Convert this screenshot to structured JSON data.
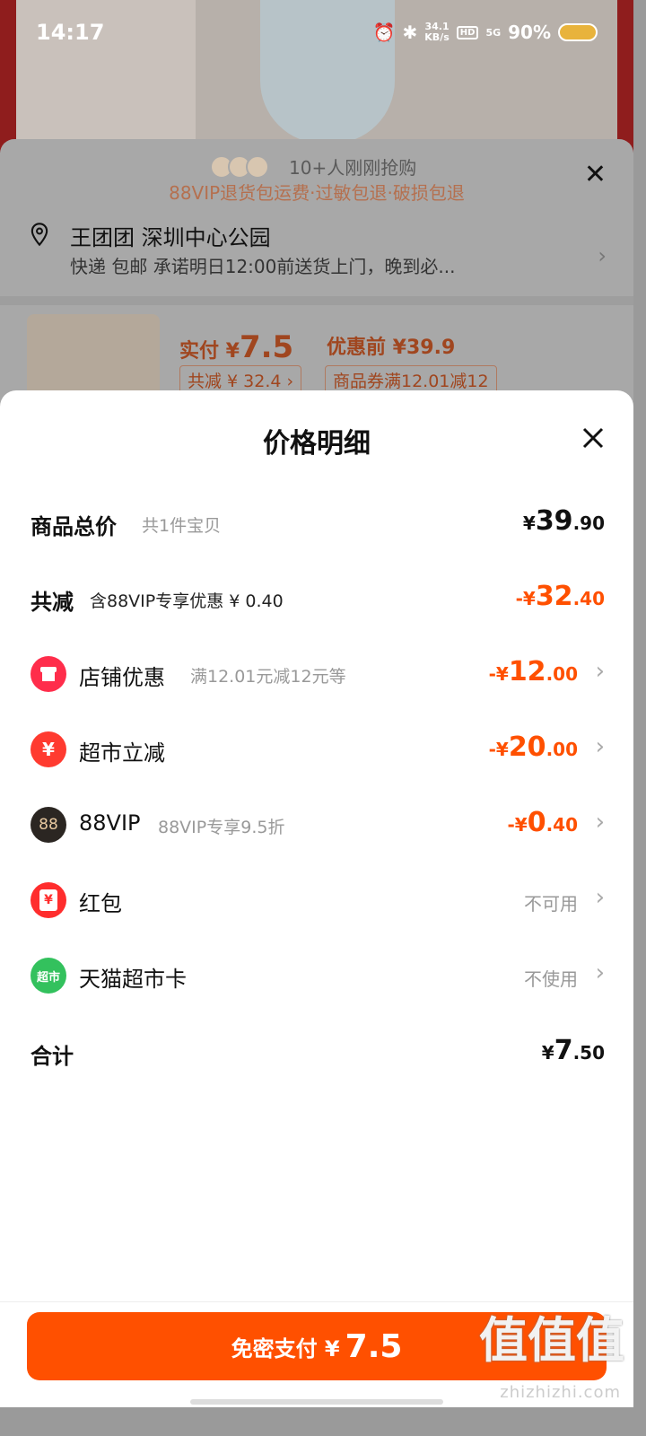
{
  "status": {
    "time": "14:17",
    "speed_top": "34.1",
    "speed_bottom": "KB/s",
    "hd": "HD",
    "net": "5G",
    "battery": "90%"
  },
  "order": {
    "recent_buyers": "10+人刚刚抢购",
    "vip_tip": "88VIP退货包运费·过敏包退·破损包退",
    "address_name": "王团团 深圳中心公园",
    "address_delivery": "快递 包邮 承诺明日12:00前送货上门，晚到必...",
    "pay_label": "实付 ¥",
    "pay_value": "7.5",
    "before_label": "优惠前 ¥39.9",
    "chip_total": "共减 ¥ 32.4 ›",
    "chip_coupon": "商品券满12.01减12"
  },
  "detail": {
    "title": "价格明细",
    "total": {
      "label": "商品总价",
      "hint": "共1件宝贝",
      "yen": "¥",
      "int": "39",
      "dec": ".90"
    },
    "reduce": {
      "label": "共减",
      "hint": "含88VIP专享优惠 ¥ 0.40",
      "yen": "-¥",
      "int": "32",
      "dec": ".40"
    },
    "items": [
      {
        "label": "店铺优惠",
        "hint": "满12.01元减12元等",
        "yen": "-¥",
        "int": "12",
        "dec": ".00",
        "icon": "store-icon",
        "color": "#ff2d4b"
      },
      {
        "label": "超市立减",
        "hint": "",
        "yen": "-¥",
        "int": "20",
        "dec": ".00",
        "icon": "yen-circle-icon",
        "color": "#ff3b30"
      },
      {
        "label": "88VIP",
        "hint": "88VIP专享9.5折",
        "yen": "-¥",
        "int": "0",
        "dec": ".40",
        "icon": "vip88-icon",
        "color": "#2b2622",
        "icon_text": "88"
      },
      {
        "label": "红包",
        "status": "不可用",
        "icon": "red-packet-icon",
        "color": "#ff2d2d",
        "icon_text": "¥"
      },
      {
        "label": "天猫超市卡",
        "status": "不使用",
        "icon": "tmall-market-card-icon",
        "color": "#33c15d",
        "icon_text": "超市"
      }
    ],
    "sum": {
      "label": "合计",
      "yen": "¥",
      "int": "7",
      "dec": ".50"
    }
  },
  "pay_button": {
    "label": "免密支付 ¥",
    "value": "7.5"
  },
  "watermark": {
    "main": "值值值",
    "site": "zhizhizhi.com"
  },
  "colors": {
    "accent": "#ff5000"
  }
}
